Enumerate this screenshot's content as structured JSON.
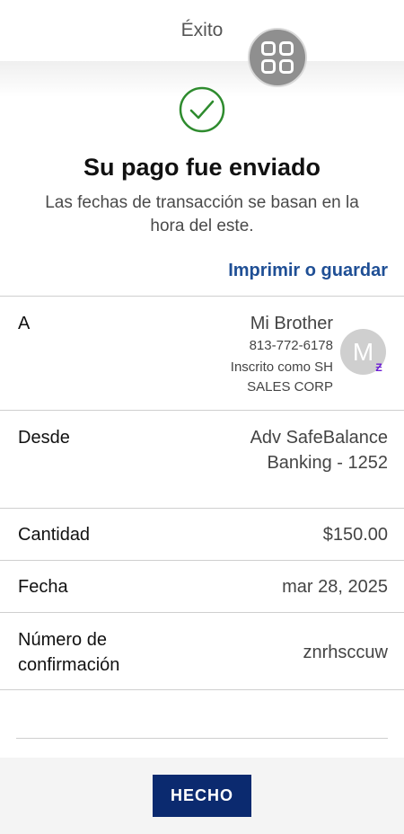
{
  "header": {
    "title": "Éxito"
  },
  "success": {
    "title": "Su pago fue enviado",
    "subtitle": "Las fechas de transacción se basan en la hora del este.",
    "print_link": "Imprimir o guardar"
  },
  "details": {
    "to": {
      "label": "A",
      "name": "Mi Brother",
      "phone": "813-772-6178",
      "enrolled_line1": "Inscrito como SH",
      "enrolled_line2": "SALES CORP",
      "avatar_initial": "M",
      "badge_icon": "zelle-icon",
      "badge_glyph": "Ƶ",
      "badge_color": "#6d1ed4"
    },
    "from": {
      "label": "Desde",
      "line1": "Adv SafeBalance",
      "line2": "Banking - 1252"
    },
    "amount": {
      "label": "Cantidad",
      "value": "$150.00"
    },
    "date": {
      "label": "Fecha",
      "value": "mar 28, 2025"
    },
    "confirmation": {
      "label_line1": "Número de",
      "label_line2": "confirmación",
      "value": "znrhsccuw"
    }
  },
  "footer": {
    "done_label": "HECHO",
    "button_color": "#0b2a6f"
  },
  "colors": {
    "link": "#1f4f95",
    "success_green": "#2e8b2e"
  }
}
